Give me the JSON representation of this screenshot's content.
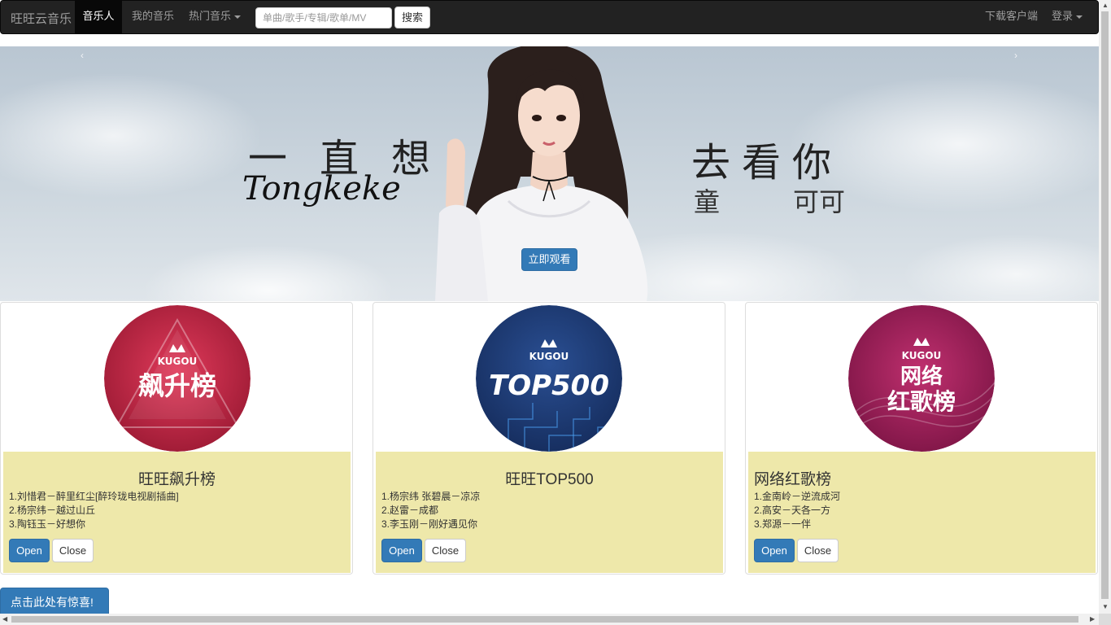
{
  "navbar": {
    "brand": "旺旺云音乐",
    "items": [
      {
        "label": "音乐人",
        "active": true
      },
      {
        "label": "我的音乐",
        "active": false
      },
      {
        "label": "热门音乐",
        "active": false
      }
    ],
    "search_placeholder": "单曲/歌手/专辑/歌单/MV",
    "search_button": "搜索",
    "download": "下载客户端",
    "login": "登录"
  },
  "carousel": {
    "prev": "‹",
    "next": "›",
    "title_left": "一直想",
    "title_right": "去看你",
    "signature": "Tongkeke",
    "artist_first": "童",
    "artist_last": "可可",
    "watch_button": "立即观看"
  },
  "cards": [
    {
      "logo_brand": "KUGOU",
      "logo_line1": "飙升榜",
      "logo_line2": "",
      "title": "旺旺飙升榜",
      "songs": [
        "1.刘惜君－醉里红尘[醉玲珑电视剧插曲]",
        "2.杨宗纬－越过山丘",
        "3.陶钰玉－好想你"
      ],
      "open": "Open",
      "close": "Close"
    },
    {
      "logo_brand": "KUGOU",
      "logo_line1": "TOP500",
      "logo_line2": "",
      "title": "旺旺TOP500",
      "songs": [
        "1.杨宗纬 张碧晨－凉凉",
        "2.赵雷－成都",
        "3.李玉刚－刚好遇见你"
      ],
      "open": "Open",
      "close": "Close"
    },
    {
      "logo_brand": "KUGOU",
      "logo_line1": "网络",
      "logo_line2": "红歌榜",
      "title": "网络红歌榜",
      "songs": [
        "1.金南岭－逆流成河",
        "2.高安－天各一方",
        "3.郑源－一伴"
      ],
      "open": "Open",
      "close": "Close"
    }
  ],
  "surprise_button": "点击此处有惊喜!",
  "colors": {
    "navbar_bg": "#222222",
    "primary": "#337ab7",
    "caption_bg": "#eee8aa",
    "card1_logo": "#b3203f",
    "card2_logo": "#1e3d7a",
    "card3_logo": "#9e1f5c"
  }
}
